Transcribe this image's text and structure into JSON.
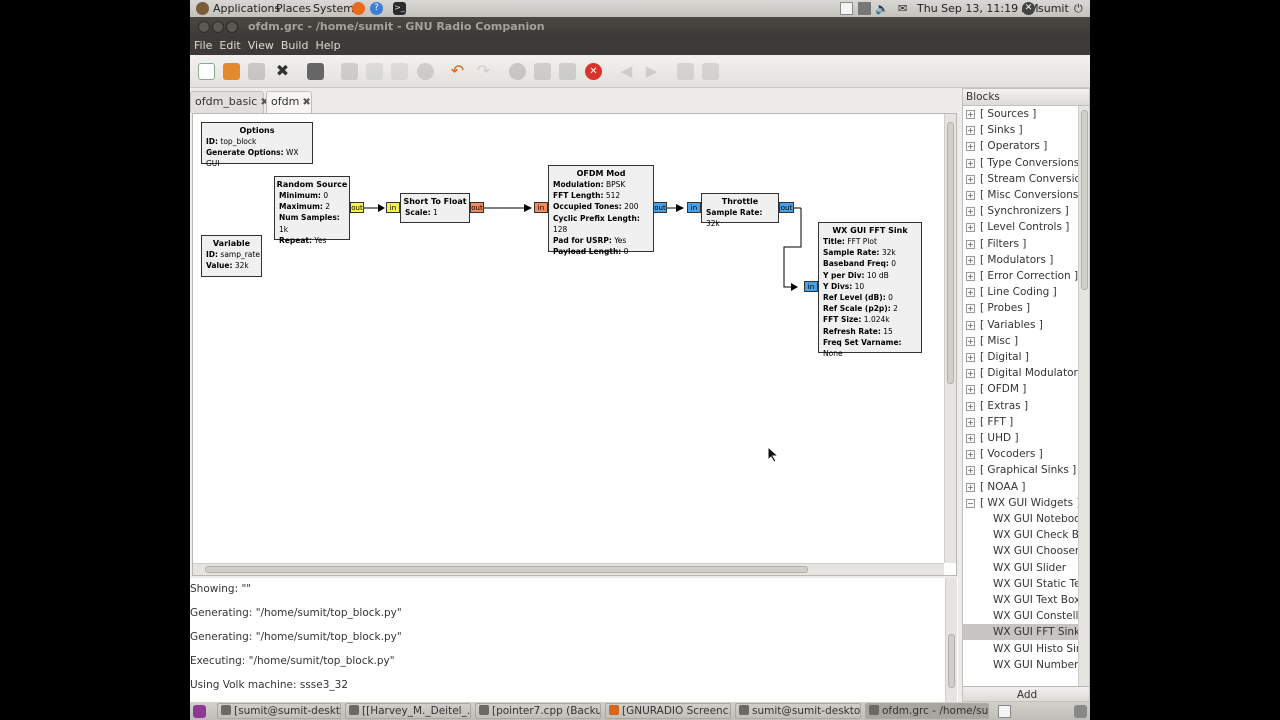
{
  "top_panel": {
    "menus": [
      "Applications",
      "Places",
      "System"
    ],
    "datetime": "Thu Sep 13, 11:19 AM",
    "user": "sumit"
  },
  "window": {
    "title": "ofdm.grc - /home/sumit - GNU Radio Companion",
    "menus": [
      "File",
      "Edit",
      "View",
      "Build",
      "Help"
    ]
  },
  "tabs": [
    {
      "label": "ofdm_basic",
      "close": "✖"
    },
    {
      "label": "ofdm",
      "close": "✖"
    }
  ],
  "flowgraph": {
    "options": {
      "title": "Options",
      "rows": [
        [
          "ID:",
          "top_block"
        ],
        [
          "Generate Options:",
          "WX GUI"
        ]
      ]
    },
    "variable": {
      "title": "Variable",
      "rows": [
        [
          "ID:",
          "samp_rate"
        ],
        [
          "Value:",
          "32k"
        ]
      ]
    },
    "random_source": {
      "title": "Random Source",
      "rows": [
        [
          "Minimum:",
          "0"
        ],
        [
          "Maximum:",
          "2"
        ],
        [
          "Num Samples:",
          "1k"
        ],
        [
          "Repeat:",
          "Yes"
        ]
      ],
      "out": "out"
    },
    "short_to_float": {
      "title": "Short To Float",
      "rows": [
        [
          "Scale:",
          "1"
        ]
      ],
      "in": "in",
      "out": "out"
    },
    "ofdm_mod": {
      "title": "OFDM Mod",
      "rows": [
        [
          "Modulation:",
          "BPSK"
        ],
        [
          "FFT Length:",
          "512"
        ],
        [
          "Occupied Tones:",
          "200"
        ],
        [
          "Cyclic Prefix Length:",
          "128"
        ],
        [
          "Pad for USRP:",
          "Yes"
        ],
        [
          "Payload Length:",
          "0"
        ]
      ],
      "in": "in",
      "out": "out"
    },
    "throttle": {
      "title": "Throttle",
      "rows": [
        [
          "Sample Rate:",
          "32k"
        ]
      ],
      "in": "in",
      "out": "out"
    },
    "fft_sink": {
      "title": "WX GUI FFT Sink",
      "rows": [
        [
          "Title:",
          "FFT Plot"
        ],
        [
          "Sample Rate:",
          "32k"
        ],
        [
          "Baseband Freq:",
          "0"
        ],
        [
          "Y per Div:",
          "10 dB"
        ],
        [
          "Y Divs:",
          "10"
        ],
        [
          "Ref Level (dB):",
          "0"
        ],
        [
          "Ref Scale (p2p):",
          "2"
        ],
        [
          "FFT Size:",
          "1.024k"
        ],
        [
          "Refresh Rate:",
          "15"
        ],
        [
          "Freq Set Varname:",
          "None"
        ]
      ],
      "in": "in"
    }
  },
  "console": [
    "Showing: \"\"",
    "Generating: \"/home/sumit/top_block.py\"",
    "Generating: \"/home/sumit/top_block.py\"",
    "Executing: \"/home/sumit/top_block.py\"",
    "Using Volk machine: ssse3_32"
  ],
  "blocks_panel": {
    "header": "Blocks",
    "categories": [
      "[ Sources ]",
      "[ Sinks ]",
      "[ Operators ]",
      "[ Type Conversions ]",
      "[ Stream Conversions",
      "[ Misc Conversions ]",
      "[ Synchronizers ]",
      "[ Level Controls ]",
      "[ Filters ]",
      "[ Modulators ]",
      "[ Error Correction ]",
      "[ Line Coding ]",
      "[ Probes ]",
      "[ Variables ]",
      "[ Misc ]",
      "[ Digital ]",
      "[ Digital Modulators ]",
      "[ OFDM ]",
      "[ Extras ]",
      "[ FFT ]",
      "[ UHD ]",
      "[ Vocoders ]",
      "[ Graphical Sinks ]",
      "[ NOAA ]",
      "[ WX GUI Widgets ]"
    ],
    "expanded_children": [
      "WX GUI Notebook",
      "WX GUI Check Box",
      "WX GUI Chooser",
      "WX GUI Slider",
      "WX GUI Static Text",
      "WX GUI Text Box",
      "WX GUI Constellati",
      "WX GUI FFT Sink",
      "WX GUI Histo Sink",
      "WX GUI Number Si"
    ],
    "selected_child": "WX GUI FFT Sink",
    "add_label": "Add"
  },
  "taskbar": [
    "[sumit@sumit-deskt...",
    "[[Harvey_M._Deitel_...",
    "[pointer7.cpp (Backu...",
    "[GNURADIO Screenc...",
    "sumit@sumit-deskto...",
    "ofdm.grc - /home/su..."
  ],
  "colors": {
    "port_in_short": "#f5f542",
    "port_complex": "#4aa0e6",
    "port_float": "#f58a5f",
    "close_red": "#d9332b"
  }
}
